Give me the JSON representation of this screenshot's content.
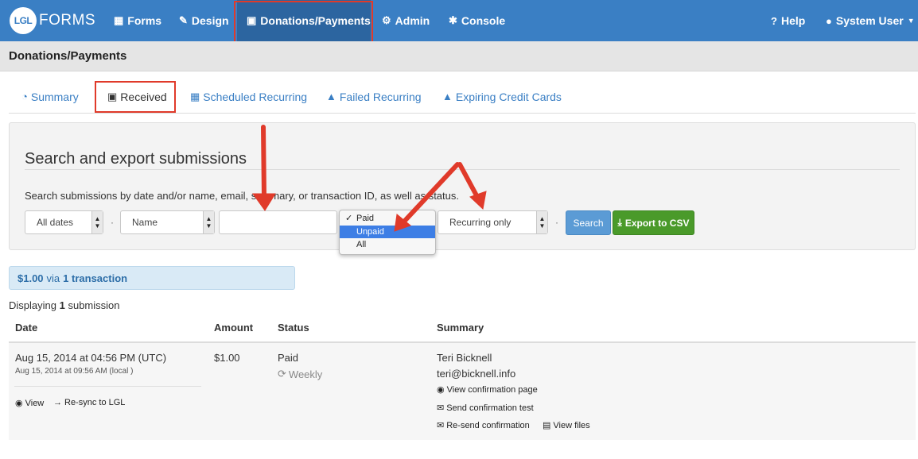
{
  "app": {
    "logo_badge": "LGL",
    "logo_text": "FORMS"
  },
  "navbar": {
    "items": [
      {
        "label": "Forms",
        "icon": "table-icon"
      },
      {
        "label": "Design",
        "icon": "pencil-icon"
      },
      {
        "label": "Donations/Payments",
        "icon": "money-icon"
      },
      {
        "label": "Admin",
        "icon": "gear-icon"
      },
      {
        "label": "Console",
        "icon": "asterisk-icon"
      }
    ],
    "help_label": "Help",
    "user_label": "System User"
  },
  "page": {
    "title": "Donations/Payments"
  },
  "tabs": [
    {
      "label": "Summary",
      "icon": "dashboard-icon"
    },
    {
      "label": "Received",
      "icon": "money-icon"
    },
    {
      "label": "Scheduled Recurring",
      "icon": "calendar-icon"
    },
    {
      "label": "Failed Recurring",
      "icon": "warning-icon"
    },
    {
      "label": "Expiring Credit Cards",
      "icon": "warning-icon"
    }
  ],
  "search": {
    "title": "Search and export submissions",
    "description": "Search submissions by date and/or name, email, summary, or transaction ID, as well as status.",
    "dates_select": "All dates",
    "field_select": "Name",
    "query_value": "",
    "status_options": [
      "Paid",
      "Unpaid",
      "All"
    ],
    "status_selected": "Paid",
    "status_highlighted": "Unpaid",
    "recurring_select": "Recurring only",
    "separator": "·",
    "search_button": "Search",
    "export_button": "Export to CSV"
  },
  "totals": {
    "amount": "$1.00",
    "via": "via",
    "count": "1 transaction"
  },
  "displaying": {
    "prefix": "Displaying",
    "count": "1",
    "suffix": "submission"
  },
  "table": {
    "headers": [
      "Date",
      "Amount",
      "Status",
      "Summary"
    ],
    "rows": [
      {
        "date": "Aug 15, 2014 at 04:56 PM (UTC)",
        "date_local": "Aug 15, 2014 at 09:56 AM (local )",
        "amount": "$1.00",
        "status": "Paid",
        "recurring": "Weekly",
        "name": "Teri Bicknell",
        "email": "teri@bicknell.info",
        "actions": {
          "view": "View",
          "resync": "Re-sync to LGL",
          "view_confirmation": "View confirmation page",
          "send_confirmation_test": "Send confirmation test",
          "resend_confirmation": "Re-send confirmation",
          "view_files": "View files"
        }
      }
    ]
  },
  "colors": {
    "navbar": "#3a7fc4",
    "navbar_active": "#2c65a0",
    "annotation_red": "#e03a2a",
    "search_button": "#5b9bd5",
    "export_button": "#4a9a2a",
    "link_blue": "#3a7fc4"
  }
}
